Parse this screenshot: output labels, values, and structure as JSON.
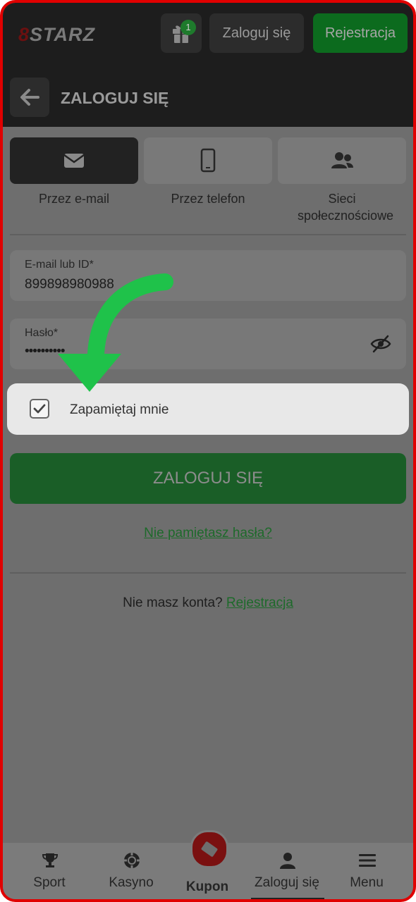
{
  "header": {
    "logo_prefix": "8",
    "logo_text": "STARZ",
    "gift_badge_count": "1",
    "login_label": "Zaloguj się",
    "register_label": "Rejestracja"
  },
  "subheader": {
    "title": "ZALOGUJ SIĘ"
  },
  "tabs": [
    {
      "label": "Przez e-mail",
      "icon": "envelope-icon",
      "active": true
    },
    {
      "label": "Przez telefon",
      "icon": "phone-icon",
      "active": false
    },
    {
      "label": "Sieci społecznościowe",
      "icon": "users-icon",
      "active": false
    }
  ],
  "form": {
    "email_label": "E-mail lub ID*",
    "email_value": "899898980988",
    "password_label": "Hasło*",
    "password_value": "••••••••••",
    "remember_label": "Zapamiętaj mnie",
    "remember_checked": true,
    "login_button": "ZALOGUJ SIĘ",
    "forgot_link": "Nie pamiętasz hasła?",
    "no_account_text": "Nie masz konta?",
    "register_link": "Rejestracja"
  },
  "bottom_nav": [
    {
      "label": "Sport",
      "icon": "trophy-icon"
    },
    {
      "label": "Kasyno",
      "icon": "casino-chip-icon"
    },
    {
      "label": "Kupon",
      "icon": "ticket-icon"
    },
    {
      "label": "Zaloguj się",
      "icon": "user-icon"
    },
    {
      "label": "Menu",
      "icon": "menu-icon"
    }
  ],
  "colors": {
    "frame_border": "#e00000",
    "highlight_arrow": "#1fc24a",
    "accent_green": "#0c6b1e",
    "brand_red": "#7a1010"
  }
}
